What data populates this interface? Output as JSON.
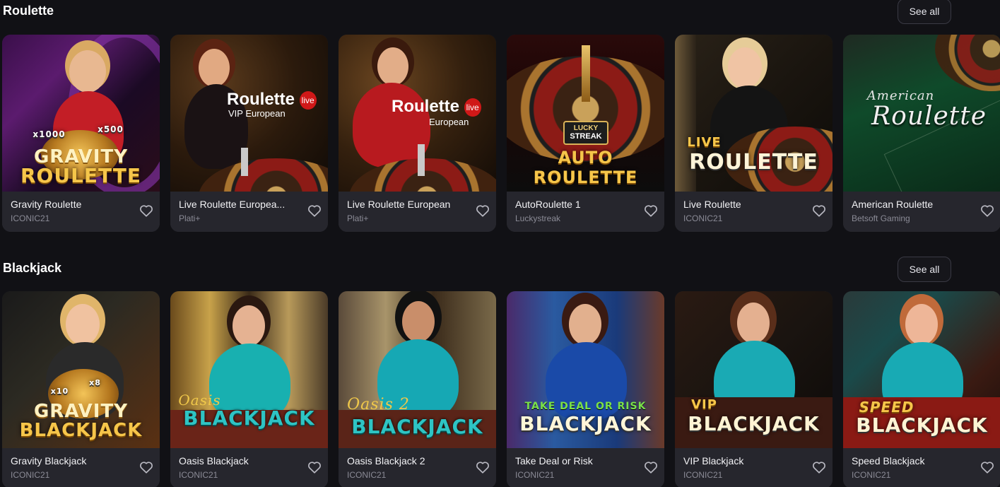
{
  "sections": [
    {
      "title": "Roulette",
      "see_all": "See all",
      "games": [
        {
          "name": "Gravity Roulette",
          "provider": "ICONIC21",
          "art": [
            "GRAVITY",
            "ROULETTE"
          ],
          "badges": [
            "x1000",
            "x500"
          ]
        },
        {
          "name": "Live Roulette Europea...",
          "provider": "Plati+",
          "art": [
            "Roulette",
            "VIP European"
          ],
          "live": "live"
        },
        {
          "name": "Live Roulette European",
          "provider": "Plati+",
          "art": [
            "Roulette",
            "European"
          ],
          "live": "live"
        },
        {
          "name": "AutoRoulette 1",
          "provider": "Luckystreak",
          "art": [
            "AUTO",
            "ROULETTE"
          ],
          "badges": [
            "LUCKY",
            "STREAK"
          ]
        },
        {
          "name": "Live Roulette",
          "provider": "ICONIC21",
          "art": [
            "LIVE",
            "ROULETTE"
          ]
        },
        {
          "name": "American Roulette",
          "provider": "Betsoft Gaming",
          "art": [
            "American",
            "Roulette"
          ]
        }
      ]
    },
    {
      "title": "Blackjack",
      "see_all": "See all",
      "games": [
        {
          "name": "Gravity Blackjack",
          "provider": "ICONIC21",
          "art": [
            "GRAVITY",
            "BLACKJACK"
          ],
          "badges": [
            "x10",
            "x8"
          ]
        },
        {
          "name": "Oasis Blackjack",
          "provider": "ICONIC21",
          "art": [
            "Oasis",
            "BLACKJACK"
          ]
        },
        {
          "name": "Oasis Blackjack 2",
          "provider": "ICONIC21",
          "art": [
            "Oasis 2",
            "BLACKJACK"
          ]
        },
        {
          "name": "Take Deal or Risk",
          "provider": "ICONIC21",
          "art": [
            "TAKE DEAL OR RISK",
            "BLACKJACK"
          ]
        },
        {
          "name": "VIP Blackjack",
          "provider": "ICONIC21",
          "art": [
            "VIP",
            "BLACKJACK"
          ]
        },
        {
          "name": "Speed Blackjack",
          "provider": "ICONIC21",
          "art": [
            "SPEED",
            "BLACKJACK"
          ]
        }
      ]
    }
  ],
  "colors": {
    "background": "#111115",
    "card": "#26262d",
    "gold": "#f6c64a",
    "provider_text": "#8b8b96"
  },
  "icons": {
    "favorite": "heart-outline-icon"
  }
}
